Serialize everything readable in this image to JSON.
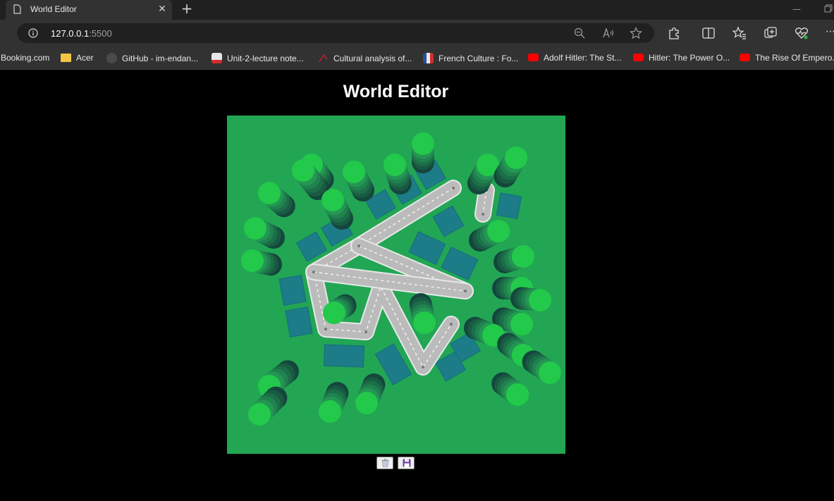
{
  "browser": {
    "tab_title": "World Editor",
    "url_host": "127.0.0.1",
    "url_port": ":5500",
    "bookmarks": [
      {
        "label": "Booking.com",
        "icon": "booking-icon"
      },
      {
        "label": "Acer",
        "icon": "folder-icon"
      },
      {
        "label": "GitHub - im-endan...",
        "icon": "github-icon"
      },
      {
        "label": "Unit-2-lecture note...",
        "icon": "pdf-icon"
      },
      {
        "label": "Cultural analysis of...",
        "icon": "site-icon"
      },
      {
        "label": "French Culture : Fo...",
        "icon": "site-icon"
      },
      {
        "label": "Adolf Hitler: The St...",
        "icon": "youtube-icon"
      },
      {
        "label": "Hitler: The Power O...",
        "icon": "youtube-icon"
      },
      {
        "label": "The Rise Of Empero...",
        "icon": "youtube-icon"
      }
    ]
  },
  "page": {
    "title": "World Editor"
  },
  "world": {
    "ground_color": "#22a654",
    "road_color": "#bbbbbb",
    "building_color": "#1c7a8a",
    "tree_color": "#23c94a",
    "buttons": [
      {
        "name": "dispose-button",
        "icon": "trash-icon"
      },
      {
        "name": "save-button",
        "icon": "floppy-disk-icon"
      }
    ]
  }
}
